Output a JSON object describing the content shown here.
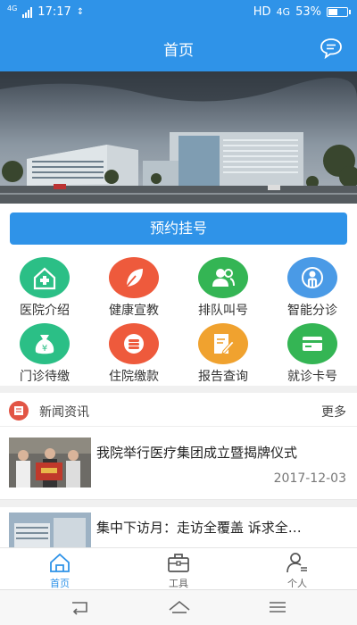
{
  "status": {
    "time": "17:17",
    "net_left": "4G",
    "hd": "HD",
    "net_right": "4G",
    "battery_pct": 53,
    "battery": "53%"
  },
  "header": {
    "title": "首页",
    "msg_icon": "chat-bubble-icon"
  },
  "banner": {
    "image": "hospital-building-photo"
  },
  "reserve": {
    "label": "预约挂号"
  },
  "grid": [
    {
      "label": "医院介绍",
      "color": "#2bbf86",
      "icon": "hospital-cross-icon"
    },
    {
      "label": "健康宣教",
      "color": "#ee5a3c",
      "icon": "leaf-icon"
    },
    {
      "label": "排队叫号",
      "color": "#34b554",
      "icon": "people-icon"
    },
    {
      "label": "智能分诊",
      "color": "#4a9ae6",
      "icon": "stethoscope-icon"
    },
    {
      "label": "门诊待缴",
      "color": "#2bbf86",
      "icon": "money-bag-icon"
    },
    {
      "label": "住院缴款",
      "color": "#ee5a3c",
      "icon": "coin-stack-icon"
    },
    {
      "label": "报告查询",
      "color": "#f0a22f",
      "icon": "report-edit-icon"
    },
    {
      "label": "就诊卡号",
      "color": "#34b554",
      "icon": "card-icon"
    }
  ],
  "news": {
    "title": "新闻资讯",
    "more": "更多",
    "items": [
      {
        "headline": "我院举行医疗集团成立暨揭牌仪式",
        "date": "2017-12-03"
      },
      {
        "headline": "集中下访月：走访全覆盖 诉求全…",
        "date": ""
      }
    ]
  },
  "tabs": [
    {
      "label": "首页",
      "icon": "home-icon",
      "active": true
    },
    {
      "label": "工具",
      "icon": "toolbox-icon",
      "active": false
    },
    {
      "label": "个人",
      "icon": "person-icon",
      "active": false
    }
  ],
  "colors": {
    "primary": "#2f93e8"
  }
}
